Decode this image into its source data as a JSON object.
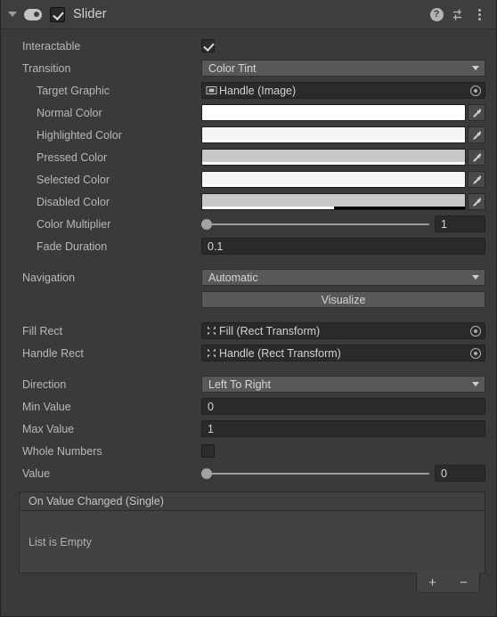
{
  "header": {
    "title": "Slider",
    "enabled_checkbox": true,
    "foldout_expanded": true,
    "icons": {
      "foldout": "triangle-down-icon",
      "component": "slider-component-icon",
      "help": "?",
      "preset": "preset-icon",
      "menu": "kebab-menu-icon"
    }
  },
  "properties": {
    "interactable": {
      "label": "Interactable",
      "value": true
    },
    "transition": {
      "label": "Transition",
      "value": "Color Tint"
    },
    "target_graphic": {
      "label": "Target Graphic",
      "value": "Handle (Image)",
      "icon": "image-component-icon"
    },
    "normal_color": {
      "label": "Normal Color",
      "color": "#ffffff",
      "alpha": 100
    },
    "highlighted_color": {
      "label": "Highlighted Color",
      "color": "#f5f5f5",
      "alpha": 100
    },
    "pressed_color": {
      "label": "Pressed Color",
      "color": "#c8c8c8",
      "alpha": 100
    },
    "selected_color": {
      "label": "Selected Color",
      "color": "#f5f5f5",
      "alpha": 100
    },
    "disabled_color": {
      "label": "Disabled Color",
      "color": "#c8c8c8",
      "alpha": 50
    },
    "color_multiplier": {
      "label": "Color Multiplier",
      "value": "1",
      "slider_pct": 0
    },
    "fade_duration": {
      "label": "Fade Duration",
      "value": "0.1"
    },
    "navigation": {
      "label": "Navigation",
      "value": "Automatic"
    },
    "visualize": {
      "label": "Visualize"
    },
    "fill_rect": {
      "label": "Fill Rect",
      "value": "Fill (Rect Transform)",
      "icon": "rect-transform-icon"
    },
    "handle_rect": {
      "label": "Handle Rect",
      "value": "Handle (Rect Transform)",
      "icon": "rect-transform-icon"
    },
    "direction": {
      "label": "Direction",
      "value": "Left To Right"
    },
    "min_value": {
      "label": "Min Value",
      "value": "0"
    },
    "max_value": {
      "label": "Max Value",
      "value": "1"
    },
    "whole_numbers": {
      "label": "Whole Numbers",
      "value": false
    },
    "value": {
      "label": "Value",
      "value": "0",
      "slider_pct": 0
    }
  },
  "event_list": {
    "title": "On Value Changed (Single)",
    "empty_message": "List is Empty",
    "add_label": "+",
    "remove_label": "−"
  },
  "colors": {
    "panel_bg": "#3a3a3a",
    "header_bg": "#3e3e3e",
    "field_bg": "#2a2a2a",
    "dropdown_bg": "#585858",
    "label_text": "#b8b8b8",
    "value_text": "#d6d6d6"
  }
}
